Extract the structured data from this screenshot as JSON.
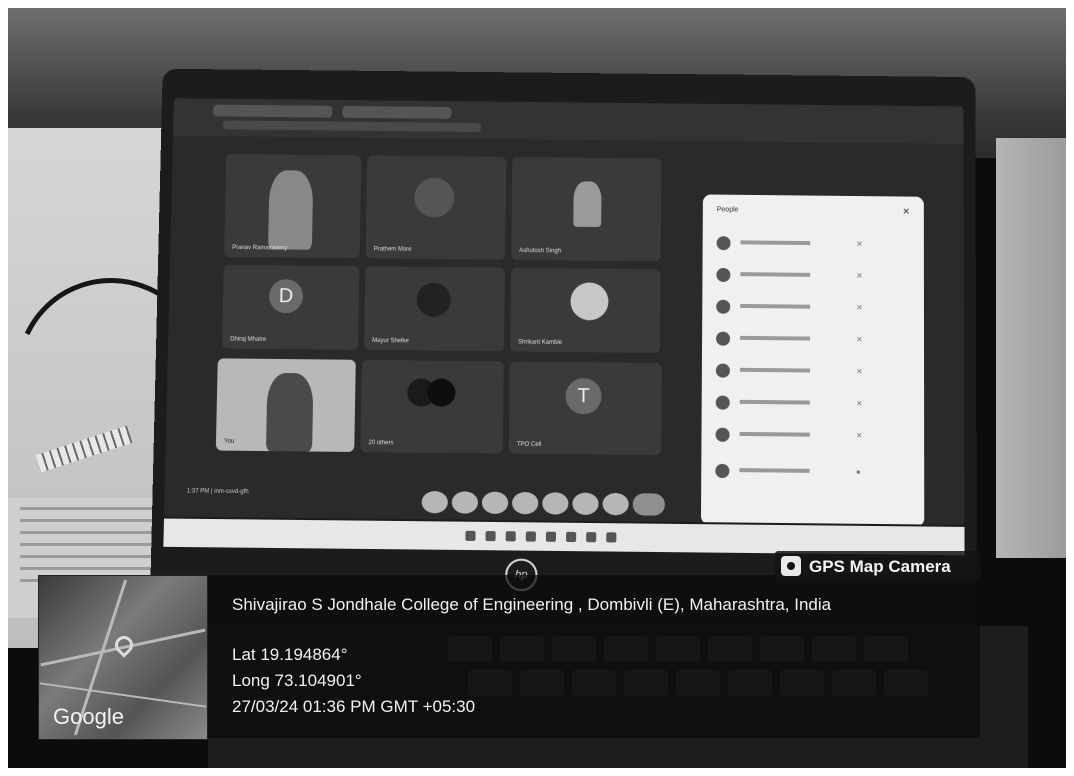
{
  "overlay": {
    "badge": "GPS Map Camera",
    "address": "Shivajirao S Jondhale College of Engineering , Dombivli (E), Maharashtra, India",
    "lat": "Lat 19.194864°",
    "long": "Long 73.104901°",
    "datetime": "27/03/24 01:36 PM GMT +05:30",
    "map_attribution": "Google"
  },
  "meeting": {
    "tiles": [
      {
        "label": "Pranav Ramaswamy"
      },
      {
        "label": "Prathem More"
      },
      {
        "label": "Ashutosh Singh"
      },
      {
        "avatar_letter": "D",
        "label": "Dhiraj Mhatre"
      },
      {
        "label": "Mayur Shelke"
      },
      {
        "label": "Shrikant Kamble"
      },
      {
        "label": "You"
      },
      {
        "label": "20 others"
      },
      {
        "avatar_letter": "T",
        "label": "TPO Cell"
      }
    ],
    "people_panel_title": "People",
    "clock": "1:37 PM | inm-sxvd-gfh"
  }
}
